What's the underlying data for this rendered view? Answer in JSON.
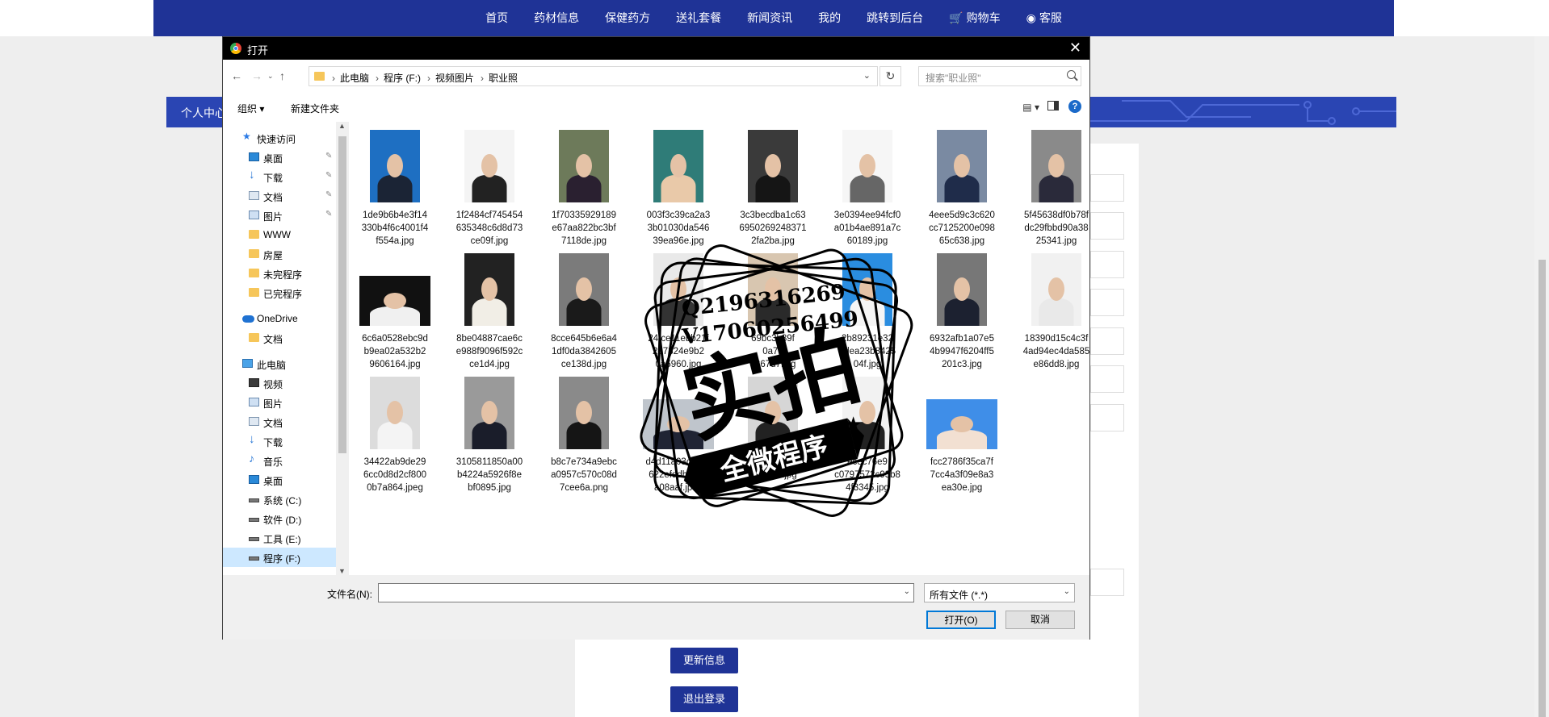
{
  "site": {
    "nav": [
      {
        "label": "首页"
      },
      {
        "label": "药材信息"
      },
      {
        "label": "保健药方"
      },
      {
        "label": "送礼套餐"
      },
      {
        "label": "新闻资讯"
      },
      {
        "label": "我的"
      },
      {
        "label": "跳转到后台"
      },
      {
        "label": "购物车",
        "icon": "cart-icon"
      },
      {
        "label": "客服",
        "icon": "chat-icon"
      }
    ],
    "banner_label": "个人中心",
    "buttons": {
      "update": "更新信息",
      "logout": "退出登录"
    }
  },
  "dialog": {
    "title": "打开",
    "breadcrumb": [
      "此电脑",
      "程序 (F:)",
      "视频图片",
      "职业照"
    ],
    "search_placeholder": "搜索\"职业照\"",
    "toolbar": {
      "organize": "组织 ▾",
      "new_folder": "新建文件夹",
      "help": "?"
    },
    "sidebar": [
      {
        "label": "快速访问",
        "icon": "star-icon",
        "level": 0,
        "pinned": false
      },
      {
        "label": "桌面",
        "icon": "desktop-icon",
        "level": 1,
        "pinned": true
      },
      {
        "label": "下载",
        "icon": "download-icon",
        "level": 1,
        "pinned": true
      },
      {
        "label": "文档",
        "icon": "document-icon",
        "level": 1,
        "pinned": true
      },
      {
        "label": "图片",
        "icon": "picture-icon",
        "level": 1,
        "pinned": true
      },
      {
        "label": "WWW",
        "icon": "folder-icon",
        "level": 1,
        "pinned": false
      },
      {
        "label": "房屋",
        "icon": "folder-icon",
        "level": 1,
        "pinned": false
      },
      {
        "label": "未完程序",
        "icon": "folder-icon",
        "level": 1,
        "pinned": false
      },
      {
        "label": "已完程序",
        "icon": "folder-icon",
        "level": 1,
        "pinned": false
      },
      {
        "label": "OneDrive",
        "icon": "cloud-icon",
        "level": 0,
        "pinned": false
      },
      {
        "label": "文档",
        "icon": "folder-icon",
        "level": 1,
        "pinned": false
      },
      {
        "label": "此电脑",
        "icon": "computer-icon",
        "level": 0,
        "pinned": false
      },
      {
        "label": "视频",
        "icon": "video-icon",
        "level": 1,
        "pinned": false
      },
      {
        "label": "图片",
        "icon": "picture-icon",
        "level": 1,
        "pinned": false
      },
      {
        "label": "文档",
        "icon": "document-icon",
        "level": 1,
        "pinned": false
      },
      {
        "label": "下载",
        "icon": "download-icon",
        "level": 1,
        "pinned": false
      },
      {
        "label": "音乐",
        "icon": "music-icon",
        "level": 1,
        "pinned": false
      },
      {
        "label": "桌面",
        "icon": "desktop-icon",
        "level": 1,
        "pinned": false
      },
      {
        "label": "系统 (C:)",
        "icon": "drive-icon",
        "level": 1,
        "pinned": false
      },
      {
        "label": "软件 (D:)",
        "icon": "drive-icon",
        "level": 1,
        "pinned": false
      },
      {
        "label": "工具 (E:)",
        "icon": "drive-icon",
        "level": 1,
        "pinned": false
      },
      {
        "label": "程序 (F:)",
        "icon": "drive-icon",
        "level": 1,
        "pinned": false,
        "selected": true
      }
    ],
    "files": [
      {
        "lines": [
          "1de9b6b4e3f14",
          "330b4f6c4001f4",
          "f554a.jpg"
        ],
        "bg": "#1e6fc2",
        "suit": "#1b2435"
      },
      {
        "lines": [
          "1f2484cf745454",
          "635348c6d8d73",
          "ce09f.jpg"
        ],
        "bg": "#f4f4f4",
        "suit": "#222"
      },
      {
        "lines": [
          "1f70335929189",
          "e67aa822bc3bf",
          "7118de.jpg"
        ],
        "bg": "#6d7a5a",
        "suit": "#2a2030"
      },
      {
        "lines": [
          "003f3c39ca2a3",
          "3b01030da546",
          "39ea96e.jpg"
        ],
        "bg": "#2f7c78",
        "suit": "#e9c9a9"
      },
      {
        "lines": [
          "3c3becdba1c63",
          "6950269248371",
          "2fa2ba.jpg"
        ],
        "bg": "#3a3a3a",
        "suit": "#151515"
      },
      {
        "lines": [
          "3e0394ee94fcf0",
          "a01b4ae891a7c",
          "60189.jpg"
        ],
        "bg": "#f6f6f6",
        "suit": "#666"
      },
      {
        "lines": [
          "4eee5d9c3c620",
          "cc7125200e098",
          "65c638.jpg"
        ],
        "bg": "#7a8aa2",
        "suit": "#1f2c4a"
      },
      {
        "lines": [
          "5f45638df0b78f",
          "dc29fbbd90a38",
          "25341.jpg"
        ],
        "bg": "#8a8a8a",
        "suit": "#2a2a3a"
      },
      {
        "lines": [
          "6c6a0528ebc9d",
          "b9ea02a532b2",
          "9606164.jpg"
        ],
        "bg": "#111",
        "suit": "#f0f0f0",
        "wide": true
      },
      {
        "lines": [
          "8be04887cae6c",
          "e988f9096f592c",
          "ce1d4.jpg"
        ],
        "bg": "#222",
        "suit": "#f1eee6"
      },
      {
        "lines": [
          "8cce645b6e6a4",
          "1df0da3842605",
          "ce138d.jpg"
        ],
        "bg": "#7b7b7b",
        "suit": "#1a1a1a"
      },
      {
        "lines": [
          "24fce11ebb21f",
          "2d7324e9b2",
          "0a5960.jpg"
        ],
        "bg": "#e9e9e9",
        "suit": "#333"
      },
      {
        "lines": [
          "69bc3b89f",
          "0a77",
          "d367d7.jpg"
        ],
        "bg": "#d8c6b0",
        "suit": "#2a2a2a"
      },
      {
        "lines": [
          "2b89231e32",
          "7dea23b8425",
          "04f.jpg"
        ],
        "bg": "#2a8de0",
        "suit": "#f5f5f5"
      },
      {
        "lines": [
          "6932afb1a07e5",
          "4b9947f6204ff5",
          "201c3.jpg"
        ],
        "bg": "#777",
        "suit": "#1c2130"
      },
      {
        "lines": [
          "18390d15c4c3f",
          "4ad94ec4da585",
          "e86dd8.jpg"
        ],
        "bg": "#f1f1f1",
        "suit": "#e9e9e9"
      },
      {
        "lines": [
          "34422ab9de29",
          "6cc0d8d2cf800",
          "0b7a864.jpeg"
        ],
        "bg": "#dcdcdc",
        "suit": "#f4f4f4"
      },
      {
        "lines": [
          "3105811850a00",
          "b4224a5926f8e",
          "bf0895.jpg"
        ],
        "bg": "#9a9a9a",
        "suit": "#1a1d2a"
      },
      {
        "lines": [
          "b8c7e734a9ebc",
          "a0957c570c08d",
          "7cee6a.png"
        ],
        "bg": "#8a8a8a",
        "suit": "#151515"
      },
      {
        "lines": [
          "d4d11a03c892c",
          "622efddb5538",
          "a08aaf.jpeg"
        ],
        "bg": "#bfc5cc",
        "suit": "#202434",
        "wide": true
      },
      {
        "lines": [
          "e65a",
          "ceebf7b.jpg"
        ],
        "bg": "#d6d6d6",
        "suit": "#222"
      },
      {
        "lines": [
          "ecec76e9",
          "c0797572c93b8",
          "4f3345.jpg"
        ],
        "bg": "#f2f2f2",
        "suit": "#222"
      },
      {
        "lines": [
          "fcc2786f35ca7f",
          "7cc4a3f09e8a3",
          "ea30e.jpg"
        ],
        "bg": "#3f8ee8",
        "suit": "#f2e0d2",
        "wide": true
      }
    ],
    "filename_label": "文件名(N):",
    "filename_value": "",
    "filetype": "所有文件 (*.*)",
    "open_label": "打开(O)",
    "cancel_label": "取消"
  },
  "watermark": {
    "line1": "Q2196316269",
    "line2": "V17060256499",
    "big": "实拍",
    "ribbon": "全微程序"
  }
}
